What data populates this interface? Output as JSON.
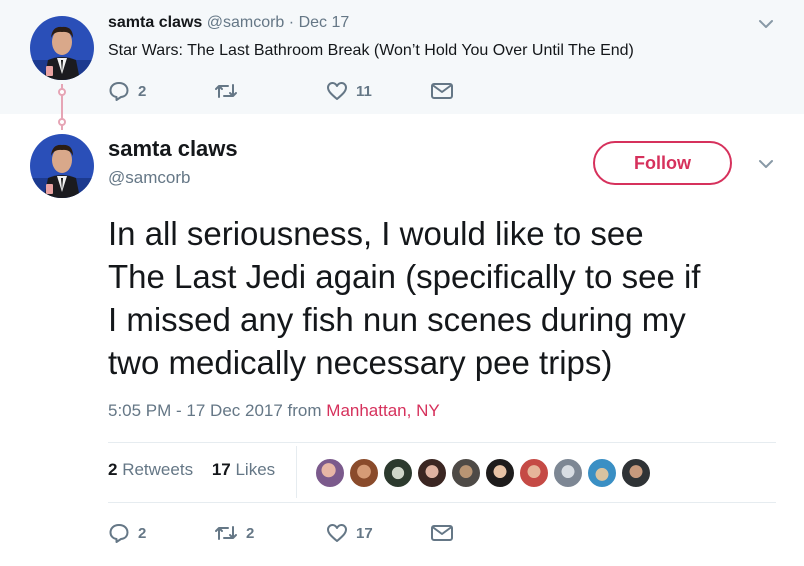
{
  "parent_tweet": {
    "name": "samta claws",
    "handle": "@samcorb",
    "separator": "·",
    "date": "Dec 17",
    "text": "Star Wars: The Last Bathroom Break (Won’t Hold You Over Until The End)",
    "replies": "2",
    "retweets": "",
    "likes": "11"
  },
  "main_tweet": {
    "name": "samta claws",
    "handle": "@samcorb",
    "follow_label": "Follow",
    "text_lines": [
      "In all seriousness, I would like to see",
      "The Last Jedi again (specifically to see if",
      "I missed any fish nun scenes during my",
      "two medically necessary pee trips)"
    ],
    "timestamp": "5:05 PM - 17 Dec 2017 from ",
    "location": "Manhattan, NY",
    "retweet_count": "2",
    "retweet_label": "Retweets",
    "like_count": "17",
    "like_label": "Likes",
    "replies": "2",
    "retweets": "2",
    "likes": "17"
  },
  "colors": {
    "accent": "#d6315c",
    "muted": "#657786",
    "parent_bg": "#f5f8fa",
    "thread_line": "#e6a5b5"
  },
  "icons": [
    "reply-icon",
    "retweet-icon",
    "like-icon",
    "direct-message-icon",
    "chevron-down-icon"
  ]
}
